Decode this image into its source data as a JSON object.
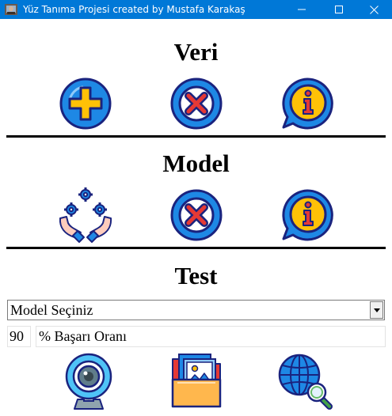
{
  "window": {
    "title": "Yüz Tanıma Projesi created by Mustafa Karakaş",
    "controls": {
      "minimize": "minimize-icon",
      "maximize": "maximize-icon",
      "close": "close-icon"
    }
  },
  "sections": {
    "veri": {
      "title": "Veri",
      "icons": [
        "add-icon",
        "delete-icon",
        "info-icon"
      ]
    },
    "model": {
      "title": "Model",
      "icons": [
        "train-icon",
        "delete-icon",
        "info-icon"
      ]
    },
    "test": {
      "title": "Test",
      "icons": [
        "webcam-icon",
        "image-folder-icon",
        "web-search-icon"
      ]
    }
  },
  "model_select": {
    "value": "Model Seçiniz"
  },
  "success_rate": {
    "value": "90",
    "label": "% Başarı Oranı"
  },
  "colors": {
    "titlebar": "#0078d7",
    "blue": "#1e88e5",
    "yellow": "#ffc107",
    "red": "#e53935",
    "outline": "#1a237e"
  }
}
